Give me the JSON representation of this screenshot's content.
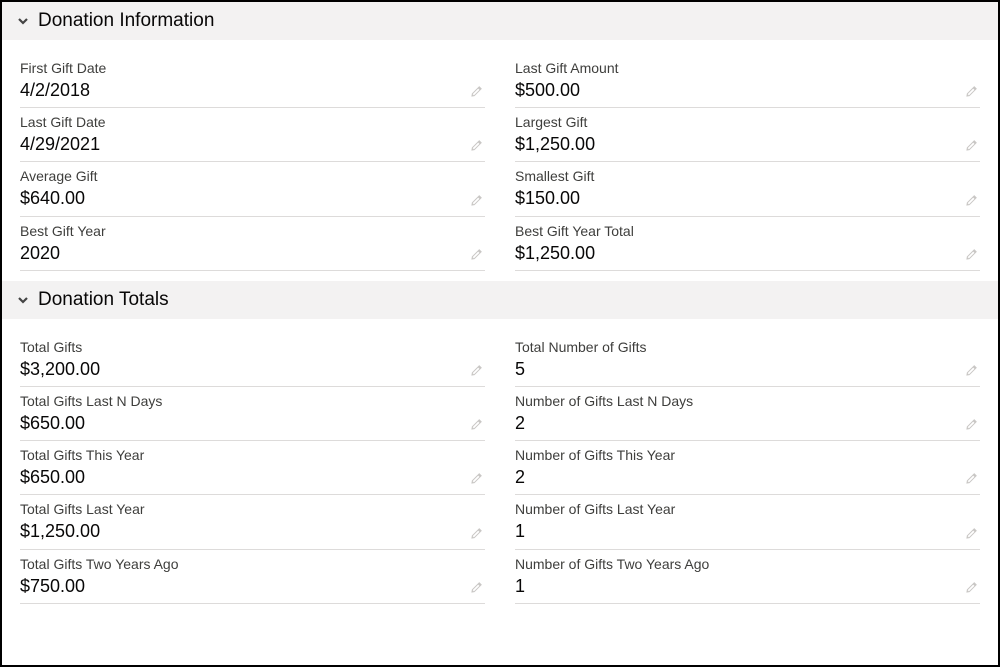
{
  "sections": {
    "donation_info": {
      "title": "Donation Information",
      "fields": {
        "first_gift_date": {
          "label": "First Gift Date",
          "value": "4/2/2018"
        },
        "last_gift_amount": {
          "label": "Last Gift Amount",
          "value": "$500.00"
        },
        "last_gift_date": {
          "label": "Last Gift Date",
          "value": "4/29/2021"
        },
        "largest_gift": {
          "label": "Largest Gift",
          "value": "$1,250.00"
        },
        "average_gift": {
          "label": "Average Gift",
          "value": "$640.00"
        },
        "smallest_gift": {
          "label": "Smallest Gift",
          "value": "$150.00"
        },
        "best_gift_year": {
          "label": "Best Gift Year",
          "value": "2020"
        },
        "best_gift_year_total": {
          "label": "Best Gift Year Total",
          "value": "$1,250.00"
        }
      }
    },
    "donation_totals": {
      "title": "Donation Totals",
      "fields": {
        "total_gifts": {
          "label": "Total Gifts",
          "value": "$3,200.00"
        },
        "total_number_of_gifts": {
          "label": "Total Number of Gifts",
          "value": "5"
        },
        "total_gifts_last_n_days": {
          "label": "Total Gifts Last N Days",
          "value": "$650.00"
        },
        "number_of_gifts_last_n_days": {
          "label": "Number of Gifts Last N Days",
          "value": "2"
        },
        "total_gifts_this_year": {
          "label": "Total Gifts This Year",
          "value": "$650.00"
        },
        "number_of_gifts_this_year": {
          "label": "Number of Gifts This Year",
          "value": "2"
        },
        "total_gifts_last_year": {
          "label": "Total Gifts Last Year",
          "value": "$1,250.00"
        },
        "number_of_gifts_last_year": {
          "label": "Number of Gifts Last Year",
          "value": "1"
        },
        "total_gifts_two_years_ago": {
          "label": "Total Gifts Two Years Ago",
          "value": "$750.00"
        },
        "number_of_gifts_two_years_ago": {
          "label": "Number of Gifts Two Years Ago",
          "value": "1"
        }
      }
    }
  }
}
